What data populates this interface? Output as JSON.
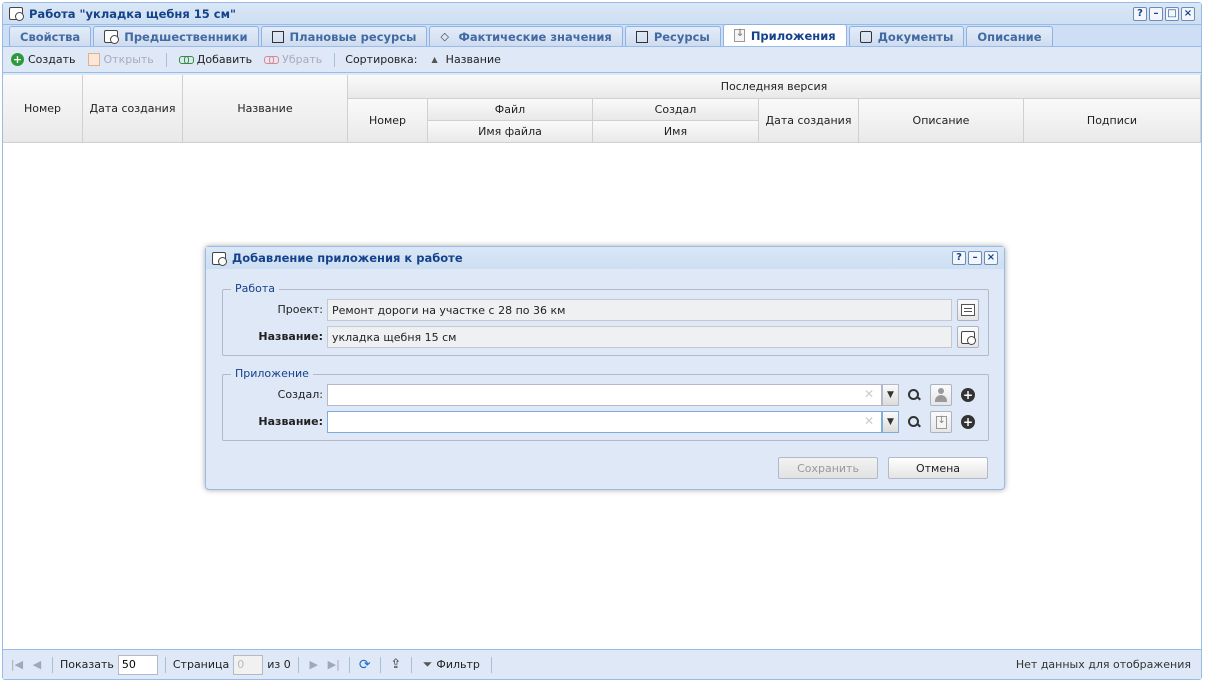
{
  "window": {
    "title": "Работа \"укладка щебня 15 см\""
  },
  "tabs": [
    {
      "label": "Свойства"
    },
    {
      "label": "Предшественники"
    },
    {
      "label": "Плановые ресурсы"
    },
    {
      "label": "Фактические значения"
    },
    {
      "label": "Ресурсы"
    },
    {
      "label": "Приложения"
    },
    {
      "label": "Документы"
    },
    {
      "label": "Описание"
    }
  ],
  "toolbar": {
    "create": "Создать",
    "open": "Открыть",
    "add": "Добавить",
    "remove": "Убрать",
    "sort_label": "Сортировка:",
    "sort_field": "Название"
  },
  "grid": {
    "col_number": "Номер",
    "col_created": "Дата создания",
    "col_name": "Название",
    "group_last_version": "Последняя версия",
    "col_ver_number": "Номер",
    "group_file": "Файл",
    "col_filename": "Имя файла",
    "group_author": "Создал",
    "col_author_name": "Имя",
    "col_ver_created": "Дата создания",
    "col_description": "Описание",
    "col_signatures": "Подписи"
  },
  "pager": {
    "show_label": "Показать",
    "page_size": "50",
    "page_label": "Страница",
    "page_value": "0",
    "of_label": "из 0",
    "filter": "Фильтр",
    "status": "Нет данных для отображения"
  },
  "dialog": {
    "title": "Добавление приложения к работе",
    "work_legend": "Работа",
    "project_label": "Проект:",
    "project_value": "Ремонт дороги на участке с 28 по 36 км",
    "name_label": "Название:",
    "name_value": "укладка щебня 15 см",
    "attachment_legend": "Приложение",
    "created_by_label": "Создал:",
    "created_by_value": "",
    "att_name_label": "Название:",
    "att_name_value": "",
    "save": "Сохранить",
    "cancel": "Отмена"
  }
}
